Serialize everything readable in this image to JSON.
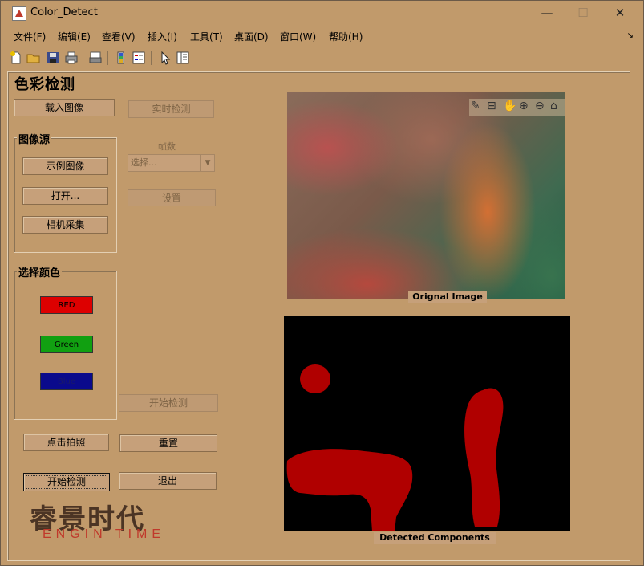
{
  "window": {
    "title": "Color_Detect",
    "minimize": "—",
    "maximize": "☐",
    "close": "✕"
  },
  "menu": [
    "文件(F)",
    "编辑(E)",
    "查看(V)",
    "插入(I)",
    "工具(T)",
    "桌面(D)",
    "窗口(W)",
    "帮助(H)"
  ],
  "toolbar_icons": [
    "new-file-icon",
    "open-folder-icon",
    "save-icon",
    "print-icon",
    "print-preview-icon",
    "colorbar-icon",
    "legend-icon",
    "pointer-icon",
    "property-editor-icon"
  ],
  "app": {
    "title": "色彩检测",
    "load_image": "载入图像",
    "realtime_detect": "实时检测",
    "frames_label": "帧数",
    "frames_select": "选择...",
    "settings": "设置",
    "image_source": {
      "title": "图像源",
      "sample": "示例图像",
      "open": "打开...",
      "camera": "相机采集"
    },
    "select_color": {
      "title": "选择颜色",
      "red": "RED",
      "green": "Green",
      "blue": "Blue"
    },
    "start_detect_disabled": "开始检测",
    "take_photo": "点击拍照",
    "reset": "重置",
    "start_detect": "开始检测",
    "exit": "退出"
  },
  "images": {
    "original_caption": "Orignal Image",
    "detected_caption": "Detected Components"
  },
  "axes_toolbar": [
    "brush-icon",
    "datatip-icon",
    "pan-hand-icon",
    "zoom-in-icon",
    "zoom-out-icon",
    "home-icon"
  ],
  "logo": {
    "cn": "睿景时代",
    "en": "ENGIN TIME"
  },
  "colors": {
    "background": "#c19a6b",
    "red_button": "#dd0000",
    "green_button": "#11a011",
    "blue_button": "#0a0a8c",
    "detect_red": "#b00000"
  }
}
